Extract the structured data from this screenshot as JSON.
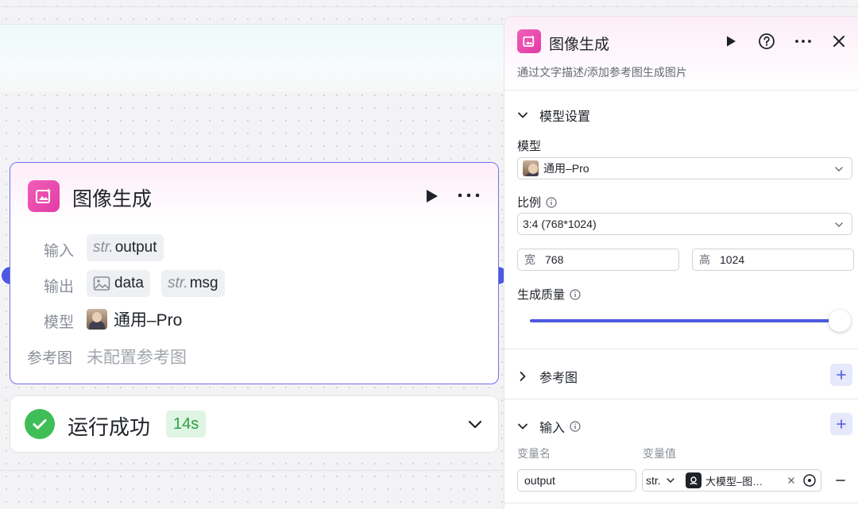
{
  "node": {
    "title": "图像生成",
    "input_label": "输入",
    "input_type": "str.",
    "input_name": "output",
    "output_label": "输出",
    "output_items": [
      {
        "icon": "image-icon",
        "name": "data"
      },
      {
        "type": "str.",
        "name": "msg"
      }
    ],
    "model_label": "模型",
    "model_value": "通用–Pro",
    "ref_label": "参考图",
    "ref_value": "未配置参考图"
  },
  "status": {
    "text": "运行成功",
    "duration": "14s"
  },
  "panel": {
    "title": "图像生成",
    "description": "通过文字描述/添加参考图生成图片",
    "model_section": "模型设置",
    "model_label": "模型",
    "model_value": "通用–Pro",
    "ratio_label": "比例",
    "ratio_value": "3:4 (768*1024)",
    "width_label": "宽",
    "width_value": "768",
    "height_label": "高",
    "height_value": "1024",
    "quality_label": "生成质量",
    "quality_level": 1.0,
    "ref_section": "参考图",
    "input_section": "输入",
    "col_var_name": "变量名",
    "col_var_value": "变量值",
    "input_row": {
      "name": "output",
      "type": "str.",
      "ref_value": "大模型–图…"
    }
  },
  "colors": {
    "accent": "#4d5ae0",
    "brand_pink": "#e23aa6",
    "success": "#3fbe57"
  }
}
